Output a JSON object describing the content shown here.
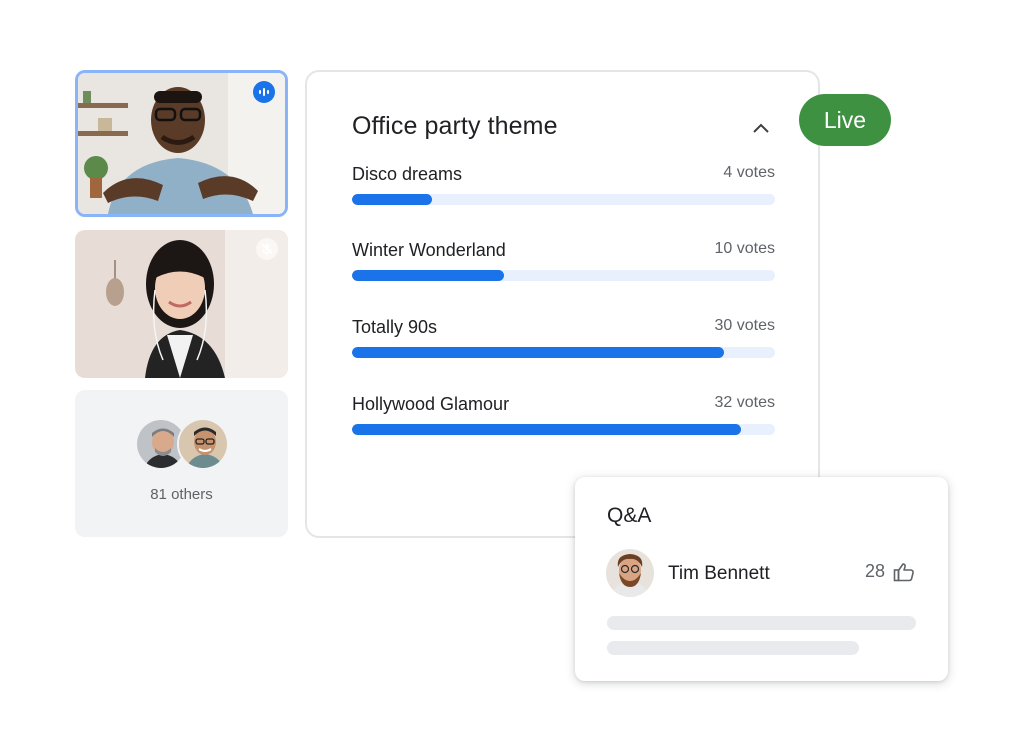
{
  "participants": {
    "others_label": "81 others",
    "speaking_icon": "audio-level-icon",
    "muted_icon": "mic-off-icon"
  },
  "poll": {
    "title": "Office party theme",
    "collapse_icon": "chevron-up-icon",
    "options": [
      {
        "label": "Disco dreams",
        "votes": "4 votes",
        "fill_fraction": 0.19
      },
      {
        "label": "Winter Wonderland",
        "votes": "10 votes",
        "fill_fraction": 0.36
      },
      {
        "label": "Totally 90s",
        "votes": "30 votes",
        "fill_fraction": 0.88
      },
      {
        "label": "Hollywood Glamour",
        "votes": "32 votes",
        "fill_fraction": 0.92
      }
    ]
  },
  "status": {
    "live_label": "Live",
    "live_color": "#3f9142"
  },
  "qa": {
    "title": "Q&A",
    "author": "Tim Bennett",
    "likes": "28",
    "like_icon": "thumbs-up-icon"
  },
  "colors": {
    "accent": "#1a73e8",
    "track": "#e8f0fe"
  }
}
